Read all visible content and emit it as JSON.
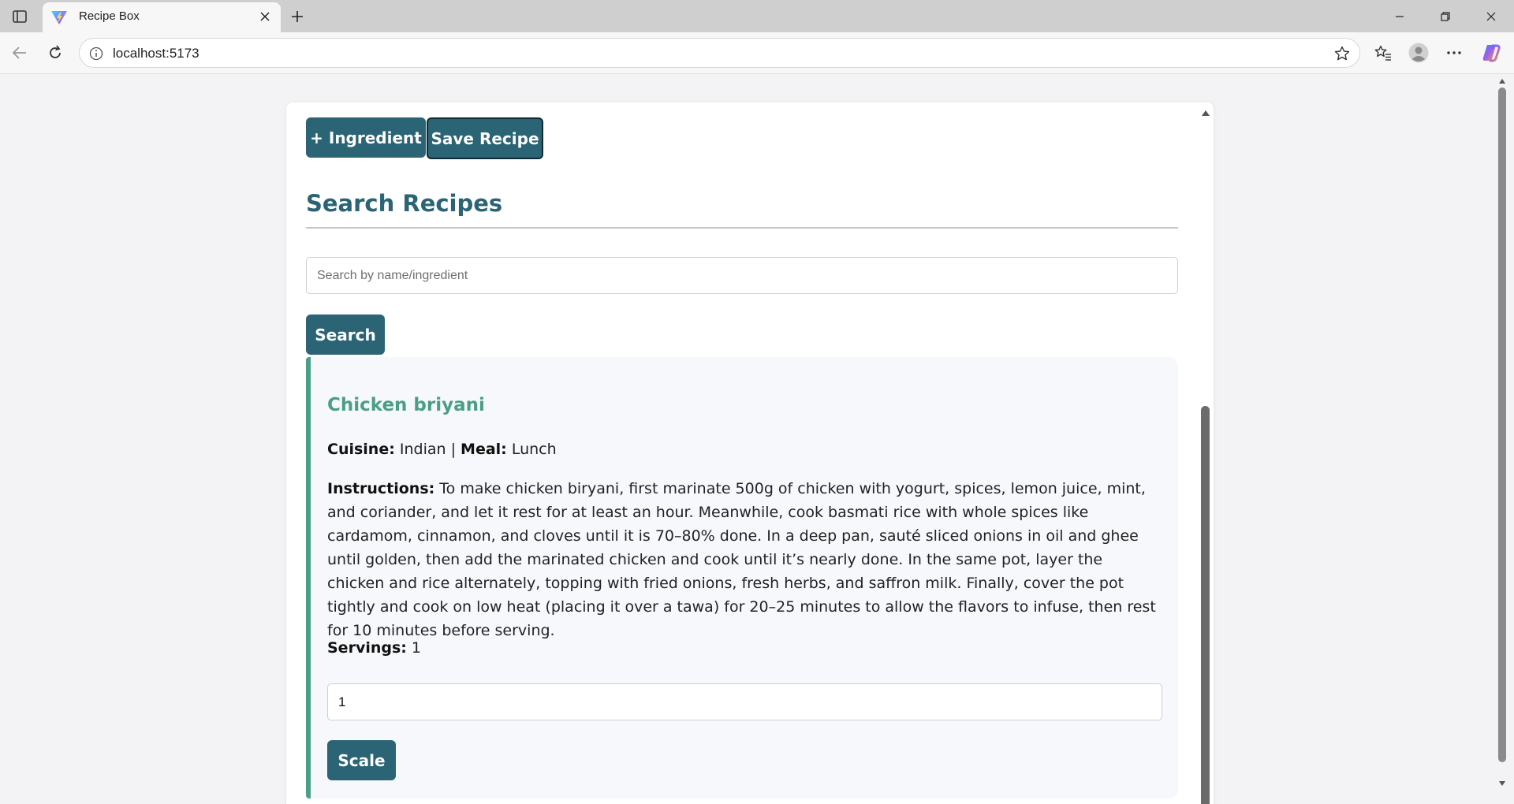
{
  "browser": {
    "tab_title": "Recipe Box",
    "url": "localhost:5173"
  },
  "toolbar": {
    "add_ingredient_label": "+ Ingredient",
    "save_recipe_label": "Save Recipe"
  },
  "search": {
    "heading": "Search Recipes",
    "placeholder": "Search by name/ingredient",
    "value": "",
    "button_label": "Search"
  },
  "recipe": {
    "title": "Chicken briyani",
    "cuisine_label": "Cuisine:",
    "cuisine": "Indian",
    "separator": "|",
    "meal_label": "Meal:",
    "meal": "Lunch",
    "instructions_label": "Instructions:",
    "instructions": "To make chicken biryani, first marinate 500g of chicken with yogurt, spices, lemon juice, mint, and coriander, and let it rest for at least an hour. Meanwhile, cook basmati rice with whole spices like cardamom, cinnamon, and cloves until it is 70–80% done. In a deep pan, sauté sliced onions in oil and ghee until golden, then add the marinated chicken and cook until it’s nearly done. In the same pot, layer the chicken and rice alternately, topping with fried onions, fresh herbs, and saffron milk. Finally, cover the pot tightly and cook on low heat (placing it over a tawa) for 20–25 minutes to allow the flavors to infuse, then rest for 10 minutes before serving.",
    "servings_label": "Servings:",
    "servings": "1",
    "scale_value": "1",
    "scale_button_label": "Scale"
  },
  "colors": {
    "primary": "#2b6474",
    "accent": "#4a9e88"
  }
}
